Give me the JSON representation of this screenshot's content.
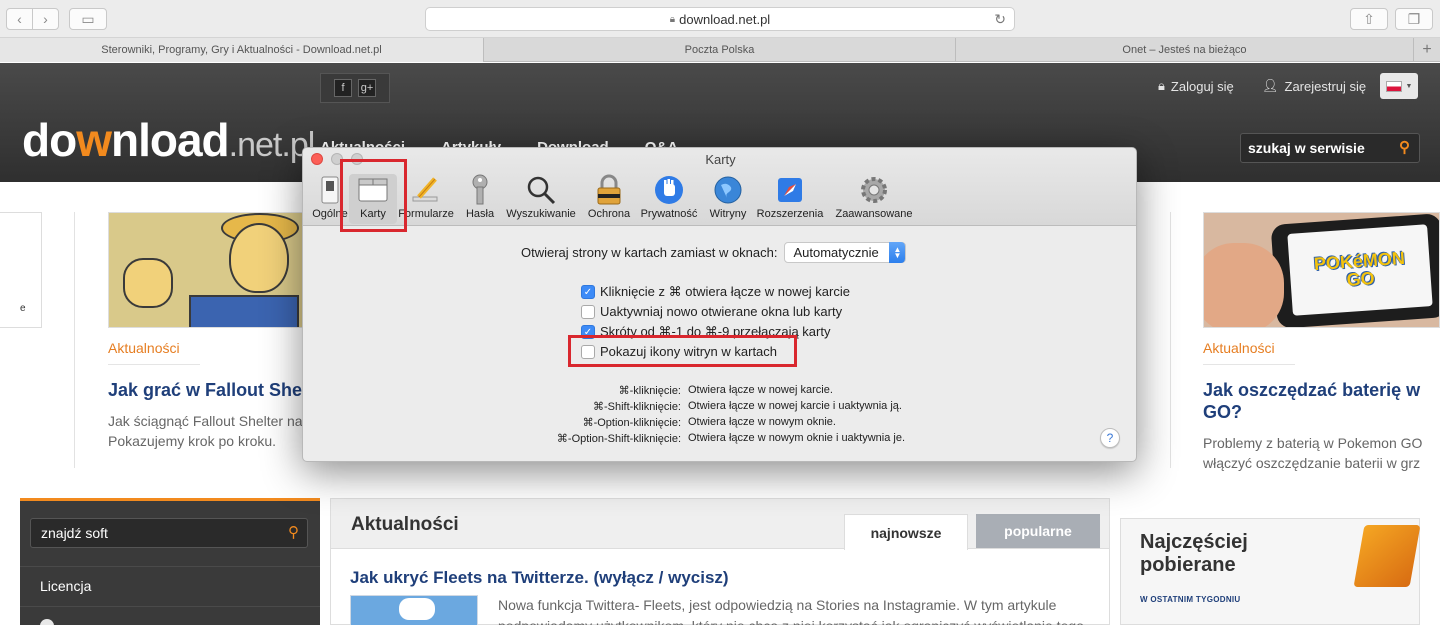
{
  "browser": {
    "url": "download.net.pl",
    "tabs": [
      "Sterowniki, Programy, Gry i Aktualności - Download.net.pl",
      "Poczta Polska",
      "Onet – Jesteś na bieżąco"
    ]
  },
  "site": {
    "logo": {
      "part1": "do",
      "part2": "w",
      "part3": "nload",
      "tld": ".net.pl"
    },
    "nav": [
      "Aktualności",
      "Artykuły",
      "Download",
      "Q&A"
    ],
    "login": "Zaloguj się",
    "register": "Zarejestruj się",
    "search_placeholder": "szukaj w serwisie",
    "left_card_fragment": "e",
    "card1": {
      "category": "Aktualności",
      "title": "Jak grać w Fallout Shelter",
      "desc1": "Jak ściągnąć Fallout Shelter na",
      "desc2": "Pokazujemy krok po kroku."
    },
    "card2": {
      "category": "Aktualności",
      "title1": "Jak oszczędzać baterię w",
      "title2": "GO?",
      "desc1": "Problemy z baterią w Pokemon GO",
      "desc2": "włączyć oszczędzanie baterii w grz",
      "thumb_text1": "POKéMON",
      "thumb_text2": "GO"
    },
    "soft_search": "znajdź soft",
    "sidebar_item": "Licencja",
    "news": {
      "heading": "Aktualności",
      "tab_new": "najnowsze",
      "tab_popular": "popularne",
      "article_title": "Jak ukryć Fleets na Twitterze. (wyłącz / wycisz)",
      "article_text": "Nowa funkcja Twittera- Fleets, jest odpowiedzią na Stories na Instagramie. W tym artykule podpowiadamy użytkownikom, który nie chcą z niej korzystać jak ograniczyć wyświetlanie tego"
    },
    "downloads": {
      "title1": "Najczęściej",
      "title2": "pobierane",
      "subtitle": "W OSTATNIM TYGODNIU"
    }
  },
  "dialog": {
    "title": "Karty",
    "tabs": [
      {
        "label": "Ogólne",
        "icon": "switch-icon"
      },
      {
        "label": "Karty",
        "icon": "tabs-icon"
      },
      {
        "label": "Formularze",
        "icon": "pencil-icon"
      },
      {
        "label": "Hasła",
        "icon": "key-icon"
      },
      {
        "label": "Wyszukiwanie",
        "icon": "magnifier-icon"
      },
      {
        "label": "Ochrona",
        "icon": "padlock-icon"
      },
      {
        "label": "Prywatność",
        "icon": "hand-icon"
      },
      {
        "label": "Witryny",
        "icon": "globe-icon"
      },
      {
        "label": "Rozszerzenia",
        "icon": "puzzle-icon"
      },
      {
        "label": "Zaawansowane",
        "icon": "gear-icon"
      }
    ],
    "open_label": "Otwieraj strony w kartach zamiast w oknach:",
    "open_value": "Automatycznie",
    "options": [
      {
        "label": "Kliknięcie z ⌘ otwiera łącze w nowej karcie",
        "checked": true
      },
      {
        "label": "Uaktywniaj nowo otwierane okna lub karty",
        "checked": false
      },
      {
        "label": "Skróty od ⌘-1 do ⌘-9 przełączają karty",
        "checked": true
      },
      {
        "label": "Pokazuj ikony witryn w kartach",
        "checked": false
      }
    ],
    "shortcuts": [
      {
        "key": "⌘-kliknięcie:",
        "desc": "Otwiera łącze w nowej karcie."
      },
      {
        "key": "⌘-Shift-kliknięcie:",
        "desc": "Otwiera łącze w nowej karcie i uaktywnia ją."
      },
      {
        "key": "⌘-Option-kliknięcie:",
        "desc": "Otwiera łącze w nowym oknie."
      },
      {
        "key": "⌘-Option-Shift-kliknięcie:",
        "desc": "Otwiera łącze w nowym oknie i uaktywnia je."
      }
    ],
    "help": "?"
  }
}
